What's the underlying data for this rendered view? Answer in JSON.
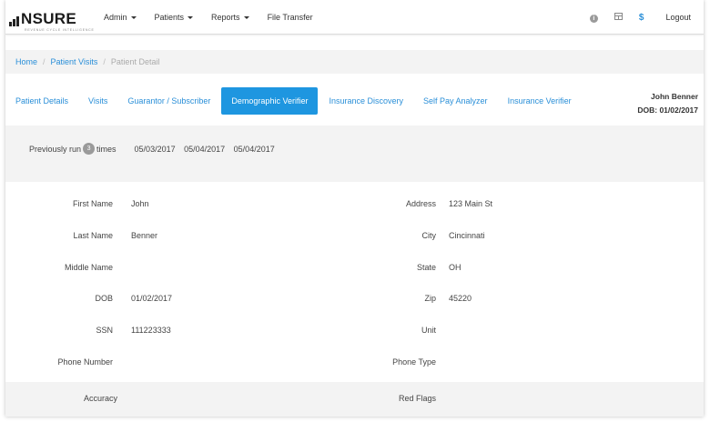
{
  "brand": {
    "name": "NSURE",
    "tagline": "REVENUE CYCLE INTELLIGENCE"
  },
  "nav": {
    "items": [
      {
        "label": "Admin",
        "dropdown": true
      },
      {
        "label": "Patients",
        "dropdown": true
      },
      {
        "label": "Reports",
        "dropdown": true
      },
      {
        "label": "File Transfer",
        "dropdown": false
      }
    ],
    "right": {
      "info_icon": "info-icon",
      "grid_icon": "table-icon",
      "dollar_label": "$",
      "logout_label": "Logout"
    }
  },
  "breadcrumb": {
    "home": "Home",
    "visits": "Patient Visits",
    "current": "Patient Detail"
  },
  "tabs": [
    {
      "label": "Patient Details"
    },
    {
      "label": "Visits"
    },
    {
      "label": "Guarantor / Subscriber"
    },
    {
      "label": "Demographic Verifier",
      "active": true
    },
    {
      "label": "Insurance Discovery"
    },
    {
      "label": "Self Pay Analyzer"
    },
    {
      "label": "Insurance Verifier"
    }
  ],
  "patient": {
    "name": "John Benner",
    "dob_label": "DOB: 01/02/2017"
  },
  "run_history": {
    "prefix": "Previously run",
    "count": "3",
    "suffix": "times",
    "dates": [
      "05/03/2017",
      "05/04/2017",
      "05/04/2017"
    ]
  },
  "form": {
    "left": [
      {
        "label": "First Name",
        "value": "John"
      },
      {
        "label": "Last Name",
        "value": "Benner"
      },
      {
        "label": "Middle Name",
        "value": ""
      },
      {
        "label": "DOB",
        "value": "01/02/2017"
      },
      {
        "label": "SSN",
        "value": "111223333"
      },
      {
        "label": "Phone Number",
        "value": ""
      },
      {
        "label": "Accuracy",
        "value": ""
      }
    ],
    "right": [
      {
        "label": "Address",
        "value": "123 Main St"
      },
      {
        "label": "City",
        "value": "Cincinnati"
      },
      {
        "label": "State",
        "value": "OH"
      },
      {
        "label": "Zip",
        "value": "45220"
      },
      {
        "label": "Unit",
        "value": ""
      },
      {
        "label": "Phone Type",
        "value": ""
      },
      {
        "label": "Red Flags",
        "value": ""
      }
    ]
  },
  "colors": {
    "accent": "#1e96e0",
    "link": "#2a8fd8",
    "panel": "#f3f3f3"
  }
}
